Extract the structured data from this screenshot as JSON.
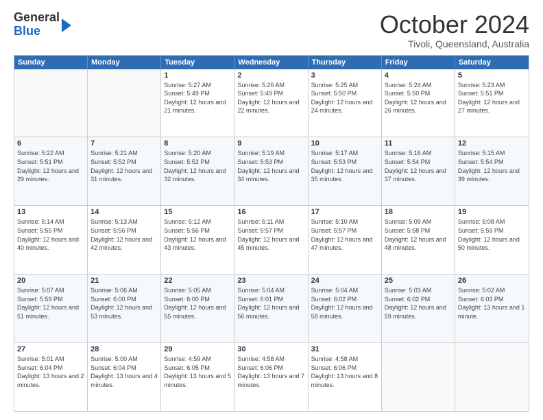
{
  "header": {
    "logo": {
      "line1": "General",
      "line2": "Blue"
    },
    "month_title": "October 2024",
    "location": "Tivoli, Queensland, Australia"
  },
  "calendar": {
    "days_of_week": [
      "Sunday",
      "Monday",
      "Tuesday",
      "Wednesday",
      "Thursday",
      "Friday",
      "Saturday"
    ],
    "weeks": [
      [
        {
          "day": "",
          "sunrise": "",
          "sunset": "",
          "daylight": "",
          "empty": true
        },
        {
          "day": "",
          "sunrise": "",
          "sunset": "",
          "daylight": "",
          "empty": true
        },
        {
          "day": "1",
          "sunrise": "Sunrise: 5:27 AM",
          "sunset": "Sunset: 5:49 PM",
          "daylight": "Daylight: 12 hours and 21 minutes.",
          "empty": false
        },
        {
          "day": "2",
          "sunrise": "Sunrise: 5:26 AM",
          "sunset": "Sunset: 5:49 PM",
          "daylight": "Daylight: 12 hours and 22 minutes.",
          "empty": false
        },
        {
          "day": "3",
          "sunrise": "Sunrise: 5:25 AM",
          "sunset": "Sunset: 5:50 PM",
          "daylight": "Daylight: 12 hours and 24 minutes.",
          "empty": false
        },
        {
          "day": "4",
          "sunrise": "Sunrise: 5:24 AM",
          "sunset": "Sunset: 5:50 PM",
          "daylight": "Daylight: 12 hours and 26 minutes.",
          "empty": false
        },
        {
          "day": "5",
          "sunrise": "Sunrise: 5:23 AM",
          "sunset": "Sunset: 5:51 PM",
          "daylight": "Daylight: 12 hours and 27 minutes.",
          "empty": false
        }
      ],
      [
        {
          "day": "6",
          "sunrise": "Sunrise: 5:22 AM",
          "sunset": "Sunset: 5:51 PM",
          "daylight": "Daylight: 12 hours and 29 minutes.",
          "empty": false
        },
        {
          "day": "7",
          "sunrise": "Sunrise: 5:21 AM",
          "sunset": "Sunset: 5:52 PM",
          "daylight": "Daylight: 12 hours and 31 minutes.",
          "empty": false
        },
        {
          "day": "8",
          "sunrise": "Sunrise: 5:20 AM",
          "sunset": "Sunset: 5:52 PM",
          "daylight": "Daylight: 12 hours and 32 minutes.",
          "empty": false
        },
        {
          "day": "9",
          "sunrise": "Sunrise: 5:19 AM",
          "sunset": "Sunset: 5:53 PM",
          "daylight": "Daylight: 12 hours and 34 minutes.",
          "empty": false
        },
        {
          "day": "10",
          "sunrise": "Sunrise: 5:17 AM",
          "sunset": "Sunset: 5:53 PM",
          "daylight": "Daylight: 12 hours and 35 minutes.",
          "empty": false
        },
        {
          "day": "11",
          "sunrise": "Sunrise: 5:16 AM",
          "sunset": "Sunset: 5:54 PM",
          "daylight": "Daylight: 12 hours and 37 minutes.",
          "empty": false
        },
        {
          "day": "12",
          "sunrise": "Sunrise: 5:15 AM",
          "sunset": "Sunset: 5:54 PM",
          "daylight": "Daylight: 12 hours and 39 minutes.",
          "empty": false
        }
      ],
      [
        {
          "day": "13",
          "sunrise": "Sunrise: 5:14 AM",
          "sunset": "Sunset: 5:55 PM",
          "daylight": "Daylight: 12 hours and 40 minutes.",
          "empty": false
        },
        {
          "day": "14",
          "sunrise": "Sunrise: 5:13 AM",
          "sunset": "Sunset: 5:56 PM",
          "daylight": "Daylight: 12 hours and 42 minutes.",
          "empty": false
        },
        {
          "day": "15",
          "sunrise": "Sunrise: 5:12 AM",
          "sunset": "Sunset: 5:56 PM",
          "daylight": "Daylight: 12 hours and 43 minutes.",
          "empty": false
        },
        {
          "day": "16",
          "sunrise": "Sunrise: 5:11 AM",
          "sunset": "Sunset: 5:57 PM",
          "daylight": "Daylight: 12 hours and 45 minutes.",
          "empty": false
        },
        {
          "day": "17",
          "sunrise": "Sunrise: 5:10 AM",
          "sunset": "Sunset: 5:57 PM",
          "daylight": "Daylight: 12 hours and 47 minutes.",
          "empty": false
        },
        {
          "day": "18",
          "sunrise": "Sunrise: 5:09 AM",
          "sunset": "Sunset: 5:58 PM",
          "daylight": "Daylight: 12 hours and 48 minutes.",
          "empty": false
        },
        {
          "day": "19",
          "sunrise": "Sunrise: 5:08 AM",
          "sunset": "Sunset: 5:59 PM",
          "daylight": "Daylight: 12 hours and 50 minutes.",
          "empty": false
        }
      ],
      [
        {
          "day": "20",
          "sunrise": "Sunrise: 5:07 AM",
          "sunset": "Sunset: 5:59 PM",
          "daylight": "Daylight: 12 hours and 51 minutes.",
          "empty": false
        },
        {
          "day": "21",
          "sunrise": "Sunrise: 5:06 AM",
          "sunset": "Sunset: 6:00 PM",
          "daylight": "Daylight: 12 hours and 53 minutes.",
          "empty": false
        },
        {
          "day": "22",
          "sunrise": "Sunrise: 5:05 AM",
          "sunset": "Sunset: 6:00 PM",
          "daylight": "Daylight: 12 hours and 55 minutes.",
          "empty": false
        },
        {
          "day": "23",
          "sunrise": "Sunrise: 5:04 AM",
          "sunset": "Sunset: 6:01 PM",
          "daylight": "Daylight: 12 hours and 56 minutes.",
          "empty": false
        },
        {
          "day": "24",
          "sunrise": "Sunrise: 5:04 AM",
          "sunset": "Sunset: 6:02 PM",
          "daylight": "Daylight: 12 hours and 58 minutes.",
          "empty": false
        },
        {
          "day": "25",
          "sunrise": "Sunrise: 5:03 AM",
          "sunset": "Sunset: 6:02 PM",
          "daylight": "Daylight: 12 hours and 59 minutes.",
          "empty": false
        },
        {
          "day": "26",
          "sunrise": "Sunrise: 5:02 AM",
          "sunset": "Sunset: 6:03 PM",
          "daylight": "Daylight: 13 hours and 1 minute.",
          "empty": false
        }
      ],
      [
        {
          "day": "27",
          "sunrise": "Sunrise: 5:01 AM",
          "sunset": "Sunset: 6:04 PM",
          "daylight": "Daylight: 13 hours and 2 minutes.",
          "empty": false
        },
        {
          "day": "28",
          "sunrise": "Sunrise: 5:00 AM",
          "sunset": "Sunset: 6:04 PM",
          "daylight": "Daylight: 13 hours and 4 minutes.",
          "empty": false
        },
        {
          "day": "29",
          "sunrise": "Sunrise: 4:59 AM",
          "sunset": "Sunset: 6:05 PM",
          "daylight": "Daylight: 13 hours and 5 minutes.",
          "empty": false
        },
        {
          "day": "30",
          "sunrise": "Sunrise: 4:58 AM",
          "sunset": "Sunset: 6:06 PM",
          "daylight": "Daylight: 13 hours and 7 minutes.",
          "empty": false
        },
        {
          "day": "31",
          "sunrise": "Sunrise: 4:58 AM",
          "sunset": "Sunset: 6:06 PM",
          "daylight": "Daylight: 13 hours and 8 minutes.",
          "empty": false
        },
        {
          "day": "",
          "sunrise": "",
          "sunset": "",
          "daylight": "",
          "empty": true
        },
        {
          "day": "",
          "sunrise": "",
          "sunset": "",
          "daylight": "",
          "empty": true
        }
      ]
    ]
  }
}
